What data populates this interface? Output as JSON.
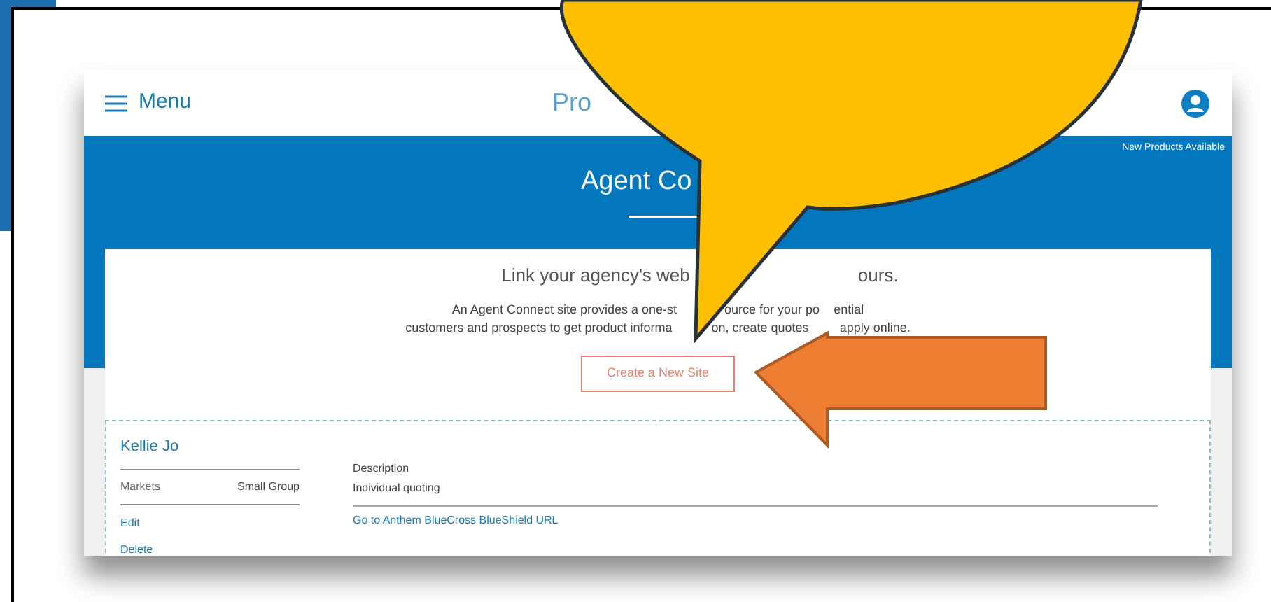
{
  "header": {
    "menu_label": "Menu",
    "title": "Pro"
  },
  "banner": {
    "notice": "New Products Available",
    "title": "Agent Co"
  },
  "intro": {
    "heading_parts": [
      "Link your agency's web",
      "ours."
    ],
    "line_1_parts": [
      "An Agent Connect site provides a one-st",
      "ource for your po",
      "ential"
    ],
    "line_2_parts": [
      "customers and prospects to get product informa",
      "on, create quotes",
      "apply online."
    ],
    "button": "Create a New Site"
  },
  "site": {
    "name": "Kellie Jo",
    "markets_label": "Markets",
    "markets_value": "Small Group",
    "actions": [
      "Edit",
      "Delete"
    ],
    "description_label": "Description",
    "description": "Individual quoting",
    "link": "Go to Anthem BlueCross BlueShield URL"
  }
}
